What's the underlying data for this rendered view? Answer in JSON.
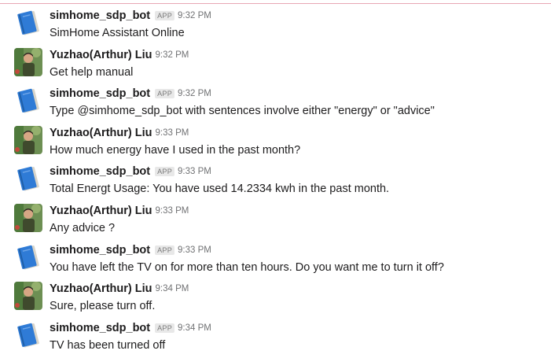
{
  "channel": {
    "messages": [
      {
        "sender": "simhome_sdp_bot",
        "badge": "APP",
        "time": "9:32 PM",
        "text": "SimHome Assistant Online",
        "avatar": "notebook-icon"
      },
      {
        "sender": "Yuzhao(Arthur) Liu",
        "badge": "",
        "time": "9:32 PM",
        "text": "Get help manual",
        "avatar": "user-photo"
      },
      {
        "sender": "simhome_sdp_bot",
        "badge": "APP",
        "time": "9:32 PM",
        "text": "Type @simhome_sdp_bot with sentences involve either \"energy\" or \"advice\"",
        "avatar": "notebook-icon"
      },
      {
        "sender": "Yuzhao(Arthur) Liu",
        "badge": "",
        "time": "9:33 PM",
        "text": "How much energy have I used in the past month?",
        "avatar": "user-photo"
      },
      {
        "sender": "simhome_sdp_bot",
        "badge": "APP",
        "time": "9:33 PM",
        "text": "Total Energt Usage: You have used 14.2334 kwh in the past month.",
        "avatar": "notebook-icon"
      },
      {
        "sender": "Yuzhao(Arthur) Liu",
        "badge": "",
        "time": "9:33 PM",
        "text": "Any advice ?",
        "avatar": "user-photo"
      },
      {
        "sender": "simhome_sdp_bot",
        "badge": "APP",
        "time": "9:33 PM",
        "text": "You have left the TV on for more than ten hours. Do you want me to turn it off?",
        "avatar": "notebook-icon"
      },
      {
        "sender": "Yuzhao(Arthur) Liu",
        "badge": "",
        "time": "9:34 PM",
        "text": "Sure, please turn off.",
        "avatar": "user-photo"
      },
      {
        "sender": "simhome_sdp_bot",
        "badge": "APP",
        "time": "9:34 PM",
        "text": "TV has been turned off",
        "avatar": "notebook-icon"
      }
    ]
  },
  "colors": {
    "divider": "#e8a7b4",
    "notebook_blue": "#2f7bd6",
    "badge_bg": "#e8e8e8",
    "time_gray": "#717274"
  }
}
